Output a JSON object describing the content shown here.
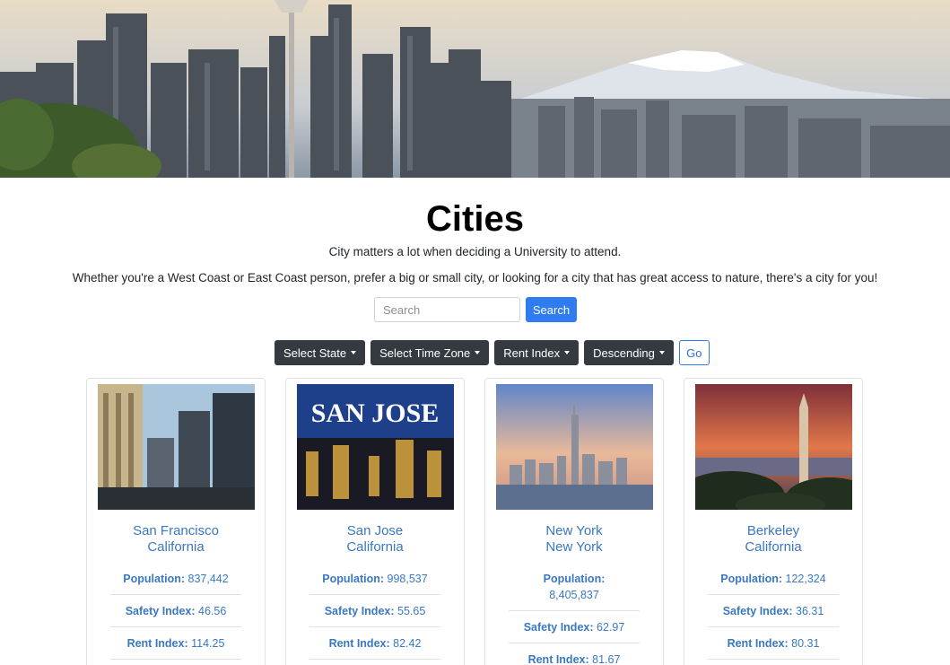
{
  "page": {
    "title": "Cities",
    "lead_1": "City matters a lot when deciding a University to attend.",
    "lead_2": "Whether you're a West Coast or East Coast person, prefer a big or small city, or looking for a city that has great access to nature, there's a city for you!"
  },
  "search": {
    "placeholder": "Search",
    "button_label": "Search"
  },
  "filters": {
    "state_label": "Select State",
    "timezone_label": "Select Time Zone",
    "sort_field_label": "Rent Index",
    "sort_order_label": "Descending",
    "go_label": "Go"
  },
  "labels": {
    "population": "Population:",
    "safety": "Safety Index:",
    "rent": "Rent Index:"
  },
  "cards": [
    {
      "city": "San Francisco",
      "state": "California",
      "population": "837,442",
      "safety": "46.56",
      "rent": "114.25"
    },
    {
      "city": "San Jose",
      "state": "California",
      "population": "998,537",
      "safety": "55.65",
      "rent": "82.42",
      "image_text": "SAN JOSE"
    },
    {
      "city": "New York",
      "state": "New York",
      "population": "8,405,837",
      "safety": "62.97",
      "rent": "81.67"
    },
    {
      "city": "Berkeley",
      "state": "California",
      "population": "122,324",
      "safety": "36.31",
      "rent": "80.31"
    }
  ],
  "colors": {
    "link_blue": "#3a78c2",
    "primary": "#2f7bf0",
    "dark": "#343a40"
  }
}
